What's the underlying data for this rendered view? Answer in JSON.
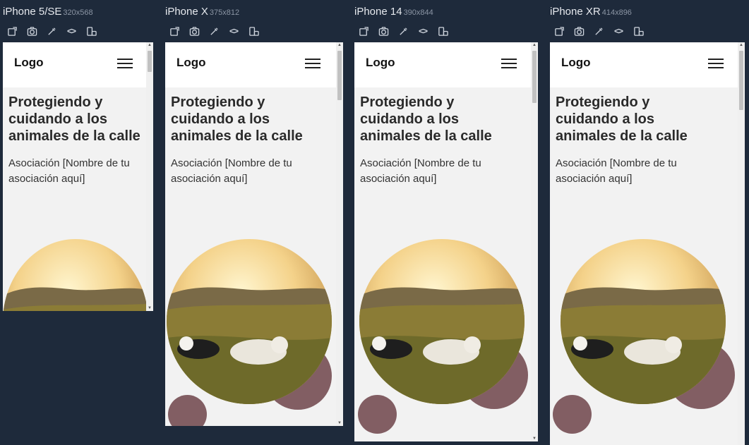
{
  "devices": [
    {
      "name": "iPhone 5/SE",
      "dims": "320x568"
    },
    {
      "name": "iPhone X",
      "dims": "375x812"
    },
    {
      "name": "iPhone 14",
      "dims": "390x844"
    },
    {
      "name": "iPhone XR",
      "dims": "414x896"
    }
  ],
  "toolbar": {
    "icons": [
      "rotate-icon",
      "screenshot-icon",
      "pick-color-icon",
      "code-icon",
      "device-rotate-icon"
    ],
    "code_glyph": "<>"
  },
  "site": {
    "logo": "Logo",
    "hero_title": "Protegiendo y cuidando a los animales de la calle",
    "hero_subtitle": "Asociación [Nombre de tu asociación aquí]",
    "colors": {
      "accent_blob": "#825e63",
      "page_bg": "#f2f2f2",
      "sun_bg": "#fdf7dd"
    }
  }
}
